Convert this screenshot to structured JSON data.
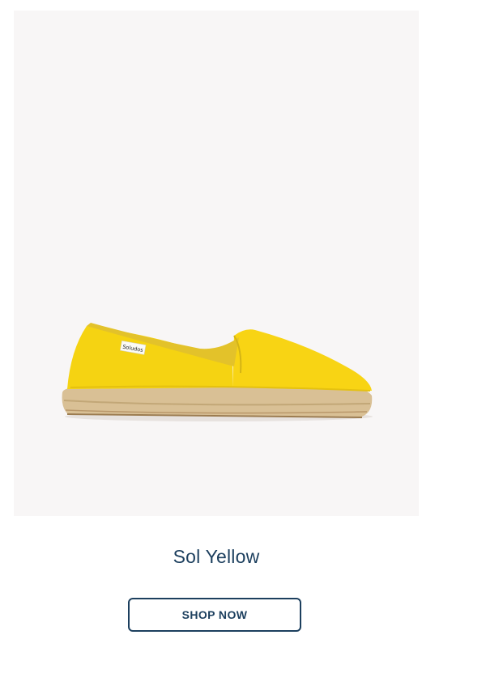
{
  "product": {
    "name": "Sol Yellow",
    "image_alt": "Sol Yellow espadrille",
    "brand_tag": "Soludos",
    "colors": {
      "canvas": "#f8d414",
      "jute": "#d9c095",
      "background": "#f8f6f6"
    }
  },
  "cta": {
    "label": "SHOP NOW"
  },
  "theme": {
    "primary": "#1c3f5e"
  }
}
